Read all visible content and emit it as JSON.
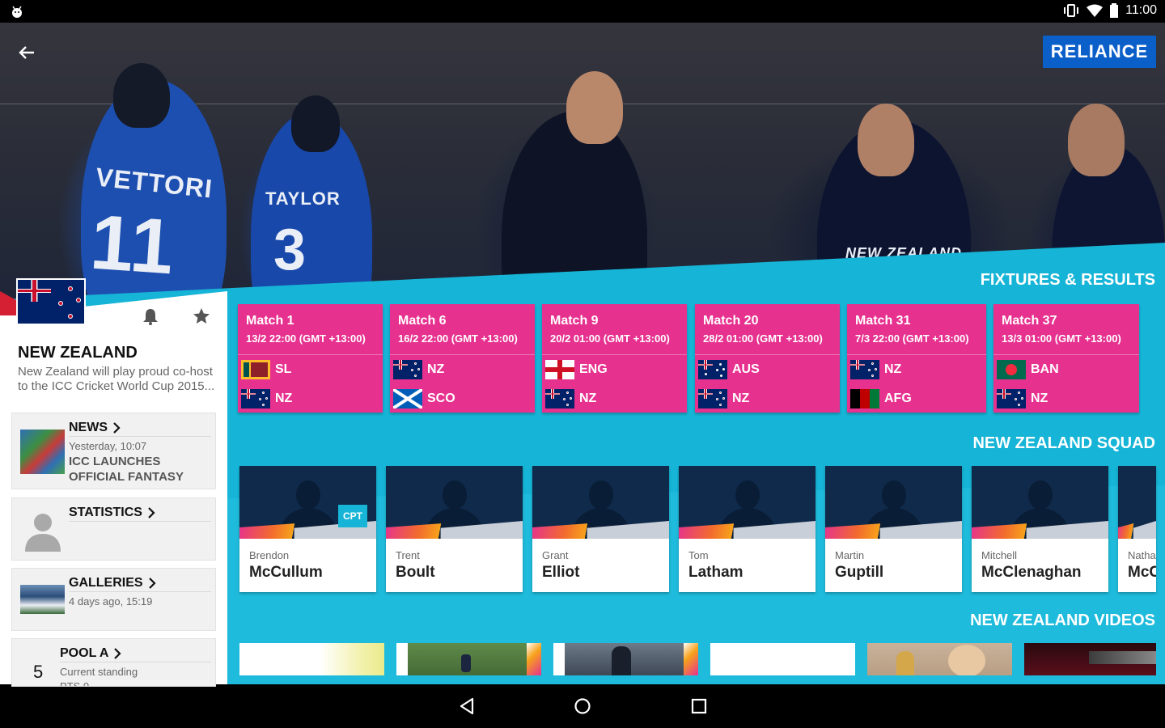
{
  "status_bar": {
    "time": "11:00"
  },
  "brand": {
    "logo_text": "RELIANCE",
    "accent": "#e6318f",
    "teal": "#16b4d6"
  },
  "hero": {
    "jersey_1_name": "VETTORI",
    "jersey_1_number": "11",
    "jersey_2_name": "TAYLOR",
    "jersey_2_number": "3",
    "jersey_3_text": "NEW ZEALAND"
  },
  "team": {
    "name": "NEW ZEALAND",
    "description_line1": "New Zealand will play proud co-host",
    "description_line2": "to the ICC Cricket World Cup 2015..."
  },
  "cards": {
    "news": {
      "title": "NEWS",
      "time": "Yesterday, 10:07",
      "headline_line1": "ICC LAUNCHES",
      "headline_line2": "OFFICIAL FANTASY"
    },
    "statistics": {
      "title": "STATISTICS"
    },
    "galleries": {
      "title": "GALLERIES",
      "time": "4 days ago, 15:19"
    },
    "pool": {
      "title": "POOL A",
      "rank": "5",
      "subtitle": "Current standing",
      "extra": "PTS 0"
    }
  },
  "sections": {
    "fixtures": "FIXTURES & RESULTS",
    "squad": "NEW ZEALAND SQUAD",
    "videos": "NEW ZEALAND VIDEOS"
  },
  "fixtures": [
    {
      "match": "Match 1",
      "time": "13/2 22:00 (GMT +13:00)",
      "team1": "SL",
      "flag1": "sl",
      "team2": "NZ",
      "flag2": "nz"
    },
    {
      "match": "Match 6",
      "time": "16/2 22:00 (GMT +13:00)",
      "team1": "NZ",
      "flag1": "nz",
      "team2": "SCO",
      "flag2": "sco"
    },
    {
      "match": "Match 9",
      "time": "20/2 01:00 (GMT +13:00)",
      "team1": "ENG",
      "flag1": "eng",
      "team2": "NZ",
      "flag2": "nz"
    },
    {
      "match": "Match 20",
      "time": "28/2 01:00 (GMT +13:00)",
      "team1": "AUS",
      "flag1": "aus",
      "team2": "NZ",
      "flag2": "nz"
    },
    {
      "match": "Match 31",
      "time": "7/3 22:00 (GMT +13:00)",
      "team1": "NZ",
      "flag1": "nz",
      "team2": "AFG",
      "flag2": "afg"
    },
    {
      "match": "Match 37",
      "time": "13/3 01:00 (GMT +13:00)",
      "team1": "BAN",
      "flag1": "ban",
      "team2": "NZ",
      "flag2": "nz"
    }
  ],
  "squad": [
    {
      "first": "Brendon",
      "last": "McCullum",
      "badge": "CPT"
    },
    {
      "first": "Trent",
      "last": "Boult",
      "badge": ""
    },
    {
      "first": "Grant",
      "last": "Elliot",
      "badge": ""
    },
    {
      "first": "Tom",
      "last": "Latham",
      "badge": ""
    },
    {
      "first": "Martin",
      "last": "Guptill",
      "badge": ""
    },
    {
      "first": "Mitchell",
      "last": "McClenaghan",
      "badge": ""
    },
    {
      "first": "Natha",
      "last": "McC",
      "badge": ""
    }
  ]
}
